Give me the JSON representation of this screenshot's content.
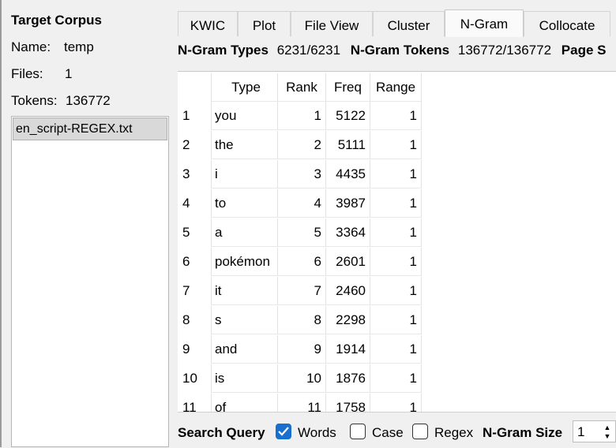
{
  "target_corpus": {
    "title": "Target Corpus",
    "name_label": "Name:",
    "name_value": "temp",
    "files_label": "Files:",
    "files_value": "1",
    "tokens_label": "Tokens:",
    "tokens_value": "136772",
    "files": [
      "en_script-REGEX.txt"
    ]
  },
  "tabs": [
    "KWIC",
    "Plot",
    "File View",
    "Cluster",
    "N-Gram",
    "Collocate"
  ],
  "active_tab": "N-Gram",
  "stats": {
    "types_label": "N-Gram Types",
    "types_value": "6231/6231",
    "tokens_label": "N-Gram Tokens",
    "tokens_value": "136772/136772",
    "page_label": "Page S"
  },
  "table": {
    "columns": [
      "Type",
      "Rank",
      "Freq",
      "Range"
    ],
    "rows": [
      {
        "idx": "1",
        "type": "you",
        "rank": "1",
        "freq": "5122",
        "range": "1"
      },
      {
        "idx": "2",
        "type": "the",
        "rank": "2",
        "freq": "5111",
        "range": "1"
      },
      {
        "idx": "3",
        "type": "i",
        "rank": "3",
        "freq": "4435",
        "range": "1"
      },
      {
        "idx": "4",
        "type": "to",
        "rank": "4",
        "freq": "3987",
        "range": "1"
      },
      {
        "idx": "5",
        "type": "a",
        "rank": "5",
        "freq": "3364",
        "range": "1"
      },
      {
        "idx": "6",
        "type": "pokémon",
        "rank": "6",
        "freq": "2601",
        "range": "1"
      },
      {
        "idx": "7",
        "type": "it",
        "rank": "7",
        "freq": "2460",
        "range": "1"
      },
      {
        "idx": "8",
        "type": "s",
        "rank": "8",
        "freq": "2298",
        "range": "1"
      },
      {
        "idx": "9",
        "type": "and",
        "rank": "9",
        "freq": "1914",
        "range": "1"
      },
      {
        "idx": "10",
        "type": "is",
        "rank": "10",
        "freq": "1876",
        "range": "1"
      },
      {
        "idx": "11",
        "type": "of",
        "rank": "11",
        "freq": "1758",
        "range": "1"
      }
    ]
  },
  "query": {
    "label": "Search Query",
    "words_label": "Words",
    "words_checked": true,
    "case_label": "Case",
    "case_checked": false,
    "regex_label": "Regex",
    "regex_checked": false,
    "ngram_size_label": "N-Gram Size",
    "ngram_size_value": "1"
  },
  "colors": {
    "accent": "#1a6ed0"
  },
  "icons": {
    "spin_up": "triangle-up",
    "spin_down": "triangle-down",
    "checkmark": "checkmark"
  }
}
